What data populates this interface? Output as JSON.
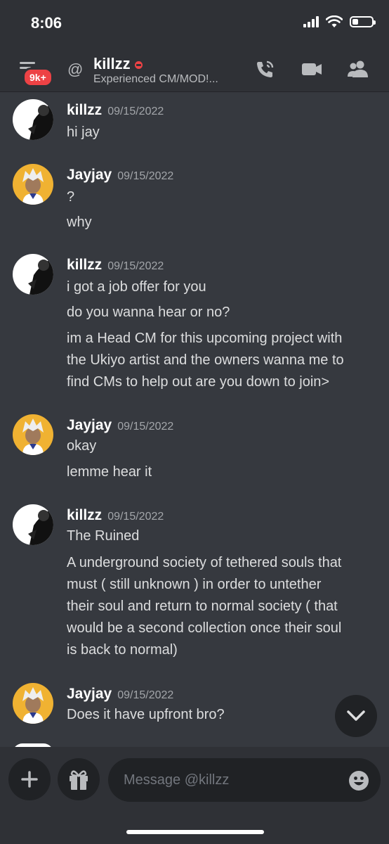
{
  "status_bar": {
    "time": "8:06"
  },
  "header": {
    "unread_badge": "9k+",
    "at_symbol": "@",
    "username": "killzz",
    "subtitle": "Experienced CM/MOD!..."
  },
  "messages": [
    {
      "author": "killzz",
      "timestamp": "09/15/2022",
      "lines": [
        "hi jay"
      ]
    },
    {
      "author": "Jayjay",
      "timestamp": "09/15/2022",
      "lines": [
        "?",
        "why"
      ]
    },
    {
      "author": "killzz",
      "timestamp": "09/15/2022",
      "lines": [
        "i got a job offer for you",
        "do you wanna hear or no?",
        "im a Head CM for this upcoming project with",
        "the Ukiyo artist and the owners wanna me to",
        "find CMs to help out are you down to join>"
      ]
    },
    {
      "author": "Jayjay",
      "timestamp": "09/15/2022",
      "lines": [
        "okay",
        "lemme hear it"
      ]
    },
    {
      "author": "killzz",
      "timestamp": "09/15/2022",
      "lines": [
        "The Ruined",
        "A underground society of tethered souls that",
        "must ( still unknown ) in order to untether",
        "their soul and return to normal society ( that",
        "would be a second collection once their soul",
        "is back to normal)"
      ]
    },
    {
      "author": "Jayjay",
      "timestamp": "09/15/2022",
      "lines": [
        "Does it have upfront bro?"
      ]
    }
  ],
  "composer": {
    "placeholder": "Message @killzz"
  },
  "icons": {
    "header": [
      "menu-icon",
      "call-icon",
      "video-icon",
      "members-icon"
    ],
    "composer": [
      "plus-icon",
      "gift-icon",
      "emoji-icon"
    ],
    "scroll": "chevron-down-icon"
  },
  "colors": {
    "background": "#36393f",
    "header_bg": "#2f3136",
    "badge_red": "#ed4245",
    "jayjay_avatar_bg": "#f0b232",
    "input_bg": "#202225"
  }
}
